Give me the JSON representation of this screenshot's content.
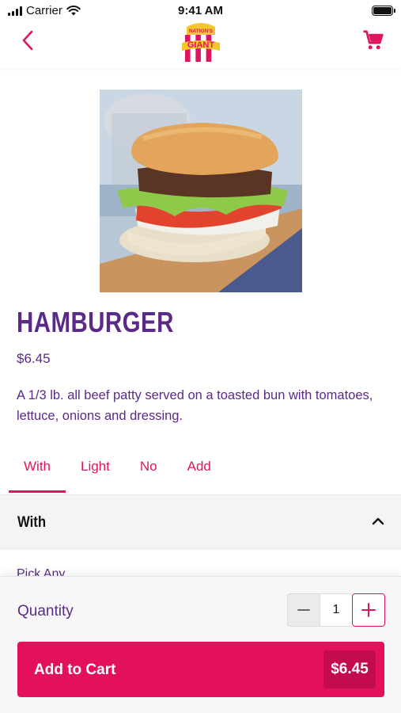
{
  "status_bar": {
    "carrier": "Carrier",
    "time": "9:41 AM"
  },
  "nav": {
    "logo_line1": "NATION'S",
    "logo_line2": "GIANT",
    "back_icon": "chevron-left-icon",
    "cart_icon": "shopping-cart-icon"
  },
  "product": {
    "name": "HAMBURGER",
    "price": "$6.45",
    "description": "A 1/3 lb. all beef patty served on a toasted bun with tomatoes, lettuce, onions and dressing."
  },
  "tabs": [
    {
      "label": "With",
      "active": true
    },
    {
      "label": "Light",
      "active": false
    },
    {
      "label": "No",
      "active": false
    },
    {
      "label": "Add",
      "active": false
    }
  ],
  "section": {
    "title": "With",
    "expanded": true,
    "hint": "Pick Any"
  },
  "quantity": {
    "label": "Quantity",
    "value": "1"
  },
  "add_to_cart": {
    "label": "Add to Cart",
    "price": "$6.45"
  },
  "colors": {
    "brand_pink": "#e0155f",
    "brand_purple": "#5b2a86"
  }
}
